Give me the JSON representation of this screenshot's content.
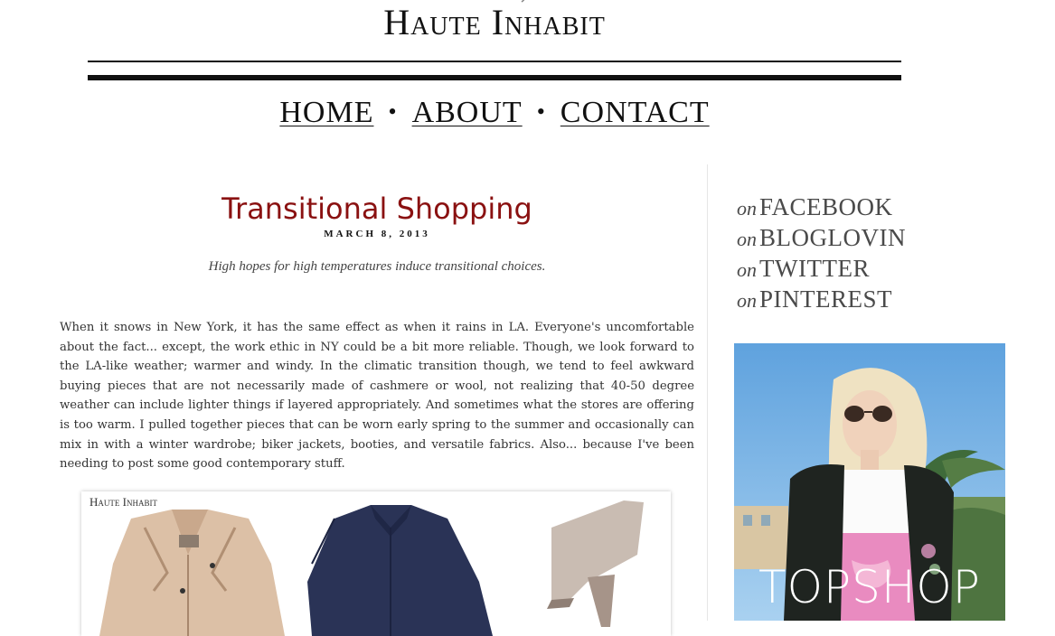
{
  "header": {
    "site_title": "Haute Inhabit",
    "nav": [
      {
        "label": "HOME"
      },
      {
        "label": "ABOUT"
      },
      {
        "label": "CONTACT"
      }
    ],
    "nav_separator": "•"
  },
  "post": {
    "title": "Transitional Shopping",
    "date": "MARCH 8, 2013",
    "subtitle": "High hopes for high temperatures induce transitional choices.",
    "body": "When it snows in New York, it has the same effect as when it rains in LA. Everyone's uncomfortable about the fact... except, the work ethic in NY could be a bit more reliable. Though, we look forward to the LA-like weather; warmer and windy. In the climatic transition though, we tend to feel awkward buying pieces that are not necessarily made of cashmere or wool, not realizing that 40-50 degree weather can include lighter things if layered appropriately. And sometimes what the stores are offering is too warm. I pulled together pieces that can be worn early spring to the summer and occasionally can mix in with a winter wardrobe; biker jackets, booties, and versatile fabrics. Also... because I've been needing to post some good contemporary stuff.",
    "collage_label": "Haute Inhabit"
  },
  "sidebar": {
    "social": [
      {
        "prefix": "on",
        "network": "FACEBOOK"
      },
      {
        "prefix": "on",
        "network": "BLOGLOVIN"
      },
      {
        "prefix": "on",
        "network": "TWITTER"
      },
      {
        "prefix": "on",
        "network": "PINTEREST"
      }
    ],
    "ad_brand": "TOPSHOP"
  },
  "colors": {
    "title_red": "#8a1111",
    "ad_pink": "#e98bc0",
    "sky": "#7fb6e6"
  }
}
